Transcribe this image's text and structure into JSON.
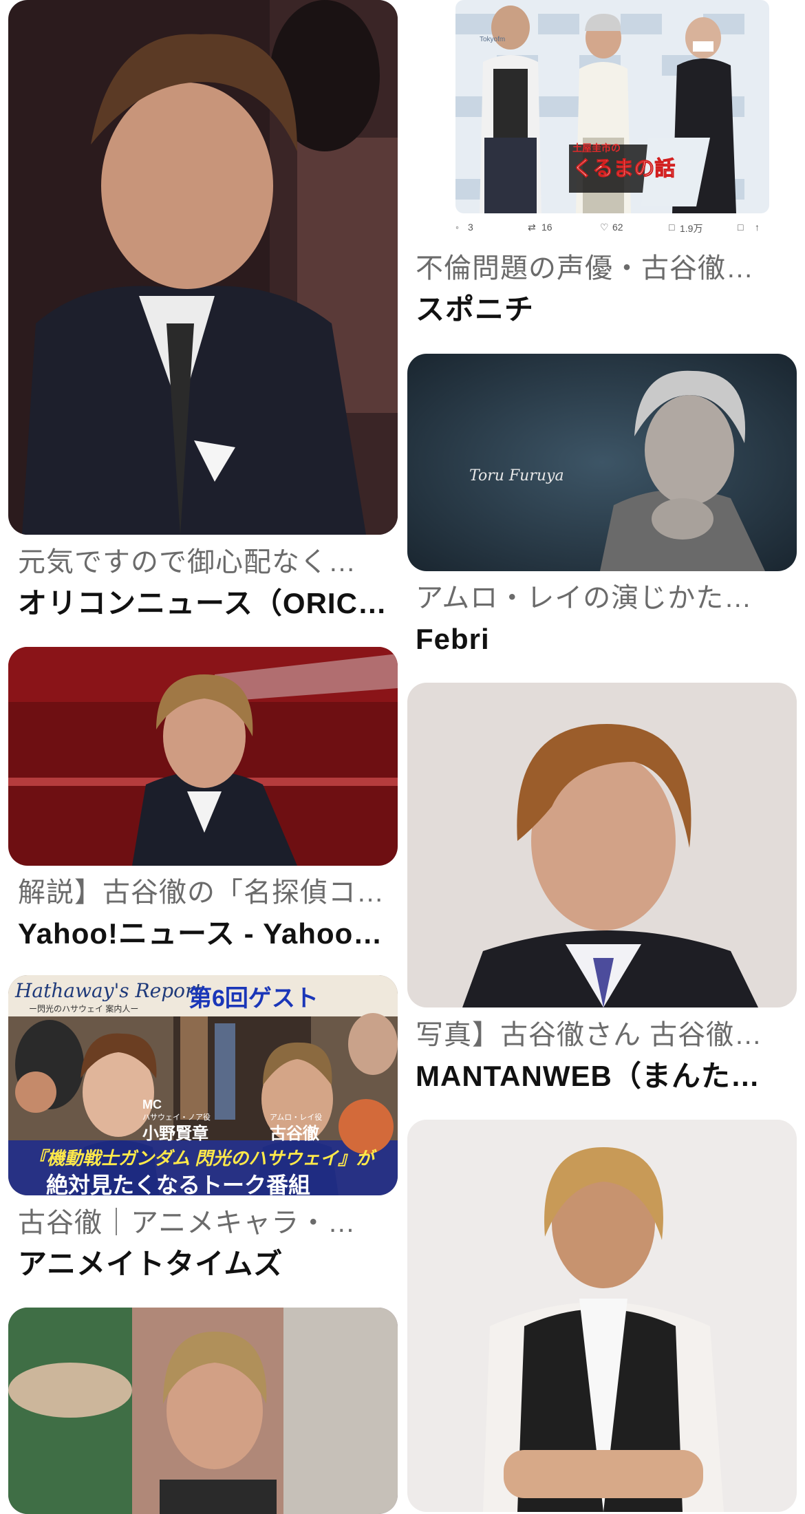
{
  "results": [
    {
      "title": "元気ですので御心配なく…",
      "source": "オリコンニュース（ORIC…"
    },
    {
      "title": "不倫問題の声優・古谷徹…",
      "source": "スポニチ"
    },
    {
      "title": "アムロ・レイの演じかた…",
      "source": "Febri"
    },
    {
      "title": "解説】古谷徹の「名探偵コ…",
      "source": "Yahoo!ニュース - Yahoo!…"
    },
    {
      "title": "写真】古谷徹さん 古谷徹…",
      "source": "MANTANWEB（まんたん…"
    },
    {
      "title": "古谷徹｜アニメキャラ・…",
      "source": "アニメイトタイムズ"
    },
    {
      "title": "",
      "source": ""
    },
    {
      "title": "",
      "source": ""
    }
  ],
  "tweet": {
    "replies": "3",
    "retweets": "16",
    "likes": "62",
    "views": "1.9万"
  },
  "overlays": {
    "hathaway_report": "Hathaway's Report",
    "hathaway_sub": "ー閃光のハサウェイ 案内人ー",
    "guest": "第6回ゲスト",
    "mc": "MC",
    "mc_role": "ハサウェイ・ノア役",
    "mc_name": "小野賢章",
    "amuro_role": "アムロ・レイ役",
    "amuro_name": "古谷徹",
    "banner1": "『機動戦士ガンダム 閃光のハサウェイ』が",
    "banner2": "絶対見たくなるトーク番組",
    "signature": "Toru Furuya",
    "radio_logo": "くるまの話",
    "radio_top": "土屋圭市の",
    "sponsor_wall": "Tokyofm"
  }
}
